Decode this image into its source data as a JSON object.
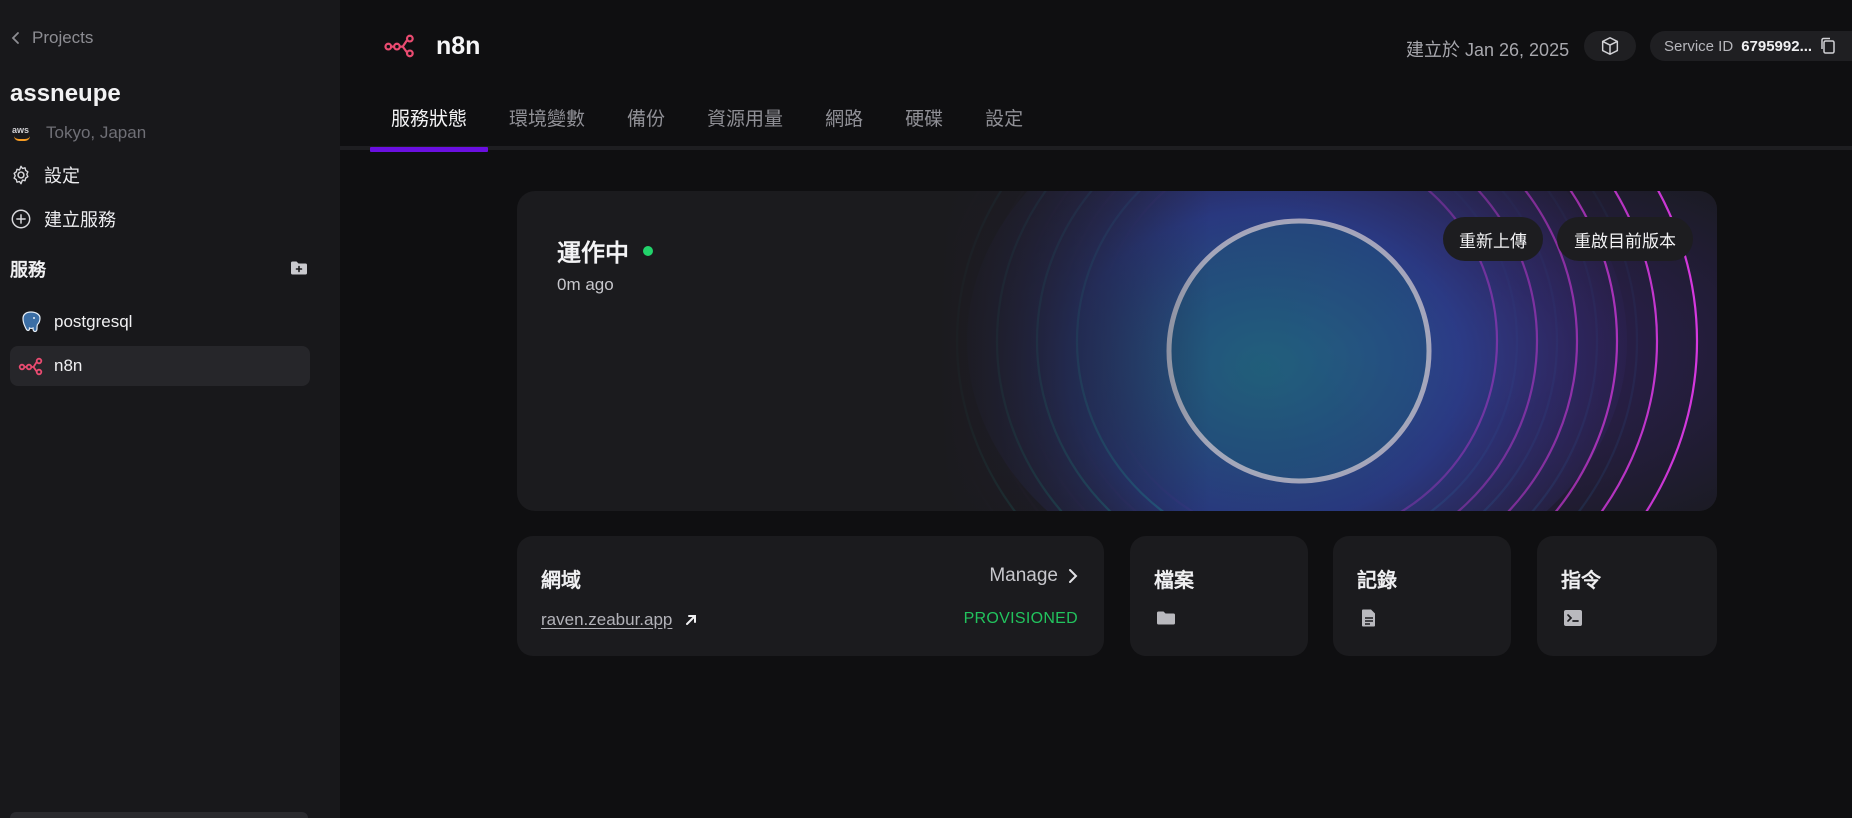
{
  "sidebar": {
    "back_label": "Projects",
    "project_name": "assneupe",
    "region": "Tokyo, Japan",
    "region_provider_mark": "aws",
    "settings_label": "設定",
    "create_service_label": "建立服務",
    "services_title": "服務",
    "services": [
      {
        "name": "postgresql",
        "icon": "postgresql-elephant-icon",
        "active": false
      },
      {
        "name": "n8n",
        "icon": "n8n-logo-icon",
        "active": true
      }
    ]
  },
  "header": {
    "service_name": "n8n",
    "created_at": "建立於 Jan 26, 2025",
    "service_id_label": "Service ID",
    "service_id_value": "6795992..."
  },
  "tabs": [
    {
      "label": "服務狀態",
      "active": true
    },
    {
      "label": "環境變數",
      "active": false
    },
    {
      "label": "備份",
      "active": false
    },
    {
      "label": "資源用量",
      "active": false
    },
    {
      "label": "網路",
      "active": false
    },
    {
      "label": "硬碟",
      "active": false
    },
    {
      "label": "設定",
      "active": false
    }
  ],
  "status_card": {
    "status": "運作中",
    "status_color": "#22d36b",
    "ago": "0m ago",
    "reupload_label": "重新上傳",
    "restart_label": "重啟目前版本"
  },
  "domain_card": {
    "title": "網域",
    "manage_label": "Manage",
    "domain": "raven.zeabur.app",
    "domain_status": "PROVISIONED",
    "domain_status_color": "#22c35e"
  },
  "cards": [
    {
      "title": "檔案",
      "icon": "folder-icon"
    },
    {
      "title": "記錄",
      "icon": "document-icon"
    },
    {
      "title": "指令",
      "icon": "terminal-icon"
    }
  ],
  "colors": {
    "accent": "#6a0fe0",
    "n8n_brand": "#ea4b71"
  }
}
